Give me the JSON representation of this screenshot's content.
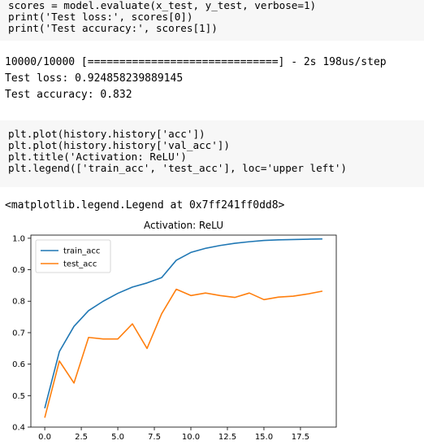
{
  "cells": {
    "evaluate_code": [
      "scores = model.evaluate(x_test, y_test, verbose=1)",
      "print('Test loss:', scores[0])",
      "print('Test accuracy:', scores[1])"
    ],
    "evaluate_output": [
      "10000/10000 [==============================] - 2s 198us/step",
      "Test loss: 0.924858239889145",
      "Test accuracy: 0.832"
    ],
    "plot_code": [
      "plt.plot(history.history['acc'])",
      "plt.plot(history.history['val_acc'])",
      "plt.title('Activation: ReLU')",
      "plt.legend(['train_acc', 'test_acc'], loc='upper left')"
    ],
    "plot_output": "<matplotlib.legend.Legend at 0x7ff241ff0dd8>"
  },
  "chart_data": {
    "type": "line",
    "title": "Activation: ReLU",
    "xlabel": "",
    "ylabel": "",
    "xlim": [
      -0.95,
      19.95
    ],
    "ylim": [
      0.4,
      1.01
    ],
    "xticks": [
      "0.0",
      "2.5",
      "5.0",
      "7.5",
      "10.0",
      "12.5",
      "15.0",
      "17.5"
    ],
    "xtick_values": [
      0,
      2.5,
      5,
      7.5,
      10,
      12.5,
      15,
      17.5
    ],
    "yticks": [
      "0.4",
      "0.5",
      "0.6",
      "0.7",
      "0.8",
      "0.9",
      "1.0"
    ],
    "ytick_values": [
      0.4,
      0.5,
      0.6,
      0.7,
      0.8,
      0.9,
      1.0
    ],
    "grid": false,
    "legend_loc": "upper-left",
    "x": [
      0,
      1,
      2,
      3,
      4,
      5,
      6,
      7,
      8,
      9,
      10,
      11,
      12,
      13,
      14,
      15,
      16,
      17,
      18,
      19
    ],
    "series": [
      {
        "name": "train_acc",
        "color": "#1f77b4",
        "values": [
          0.46,
          0.64,
          0.72,
          0.77,
          0.8,
          0.825,
          0.845,
          0.858,
          0.875,
          0.93,
          0.955,
          0.968,
          0.977,
          0.984,
          0.989,
          0.993,
          0.995,
          0.996,
          0.997,
          0.998
        ]
      },
      {
        "name": "test_acc",
        "color": "#ff7f0e",
        "values": [
          0.43,
          0.61,
          0.54,
          0.685,
          0.68,
          0.68,
          0.728,
          0.65,
          0.76,
          0.838,
          0.818,
          0.826,
          0.818,
          0.812,
          0.826,
          0.805,
          0.813,
          0.816,
          0.823,
          0.832
        ]
      }
    ]
  }
}
